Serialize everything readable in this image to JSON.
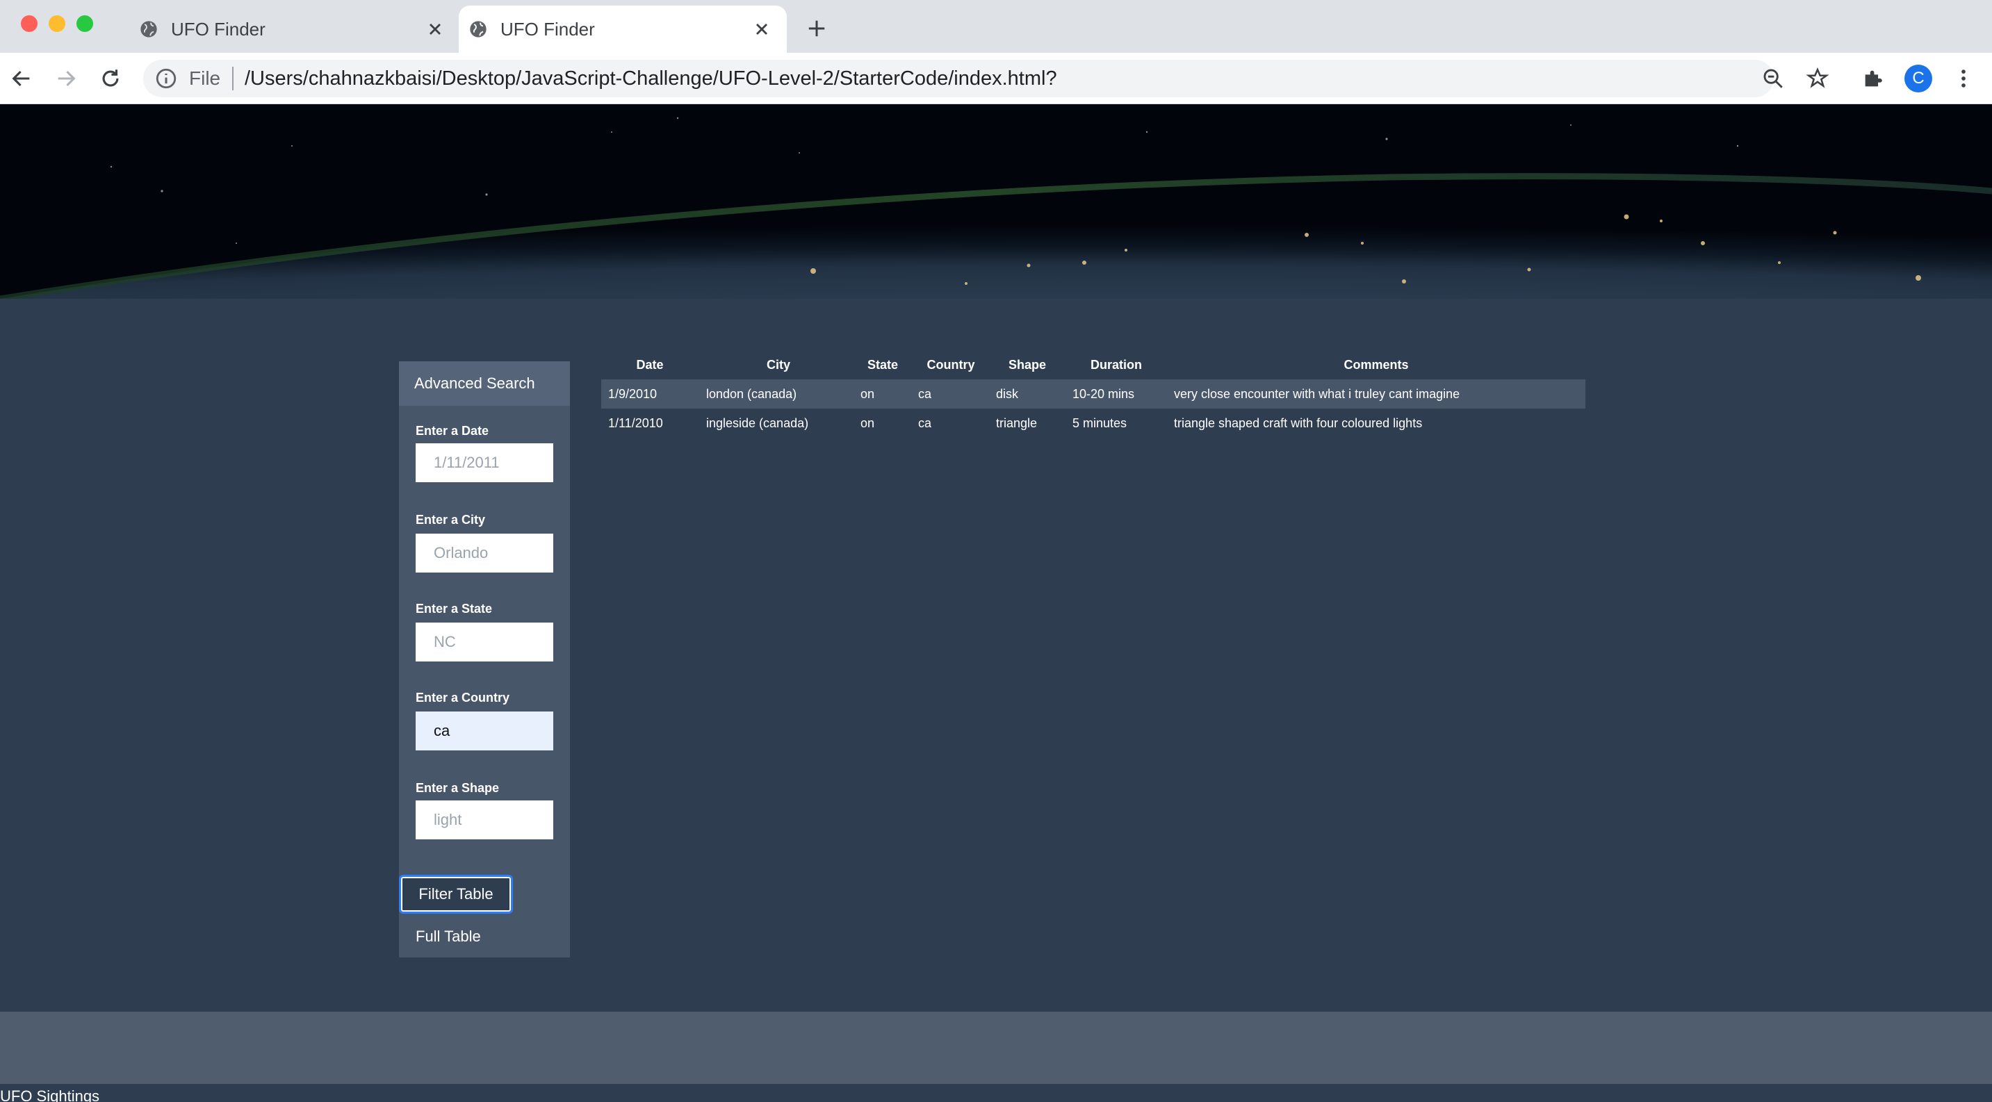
{
  "browser": {
    "tabs": [
      {
        "title": "UFO Finder",
        "active": false
      },
      {
        "title": "UFO Finder",
        "active": true
      }
    ],
    "omnibox": {
      "scheme_label": "File",
      "url": "/Users/chahnazkbaisi/Desktop/JavaScript-Challenge/UFO-Level-2/StarterCode/index.html?"
    },
    "profile_initial": "C",
    "colors": {
      "tab_strip": "#dee1e6",
      "profile": "#1a73e8",
      "close_red": "#ff5f57",
      "minimize_yellow": "#febc2e",
      "maximize_green": "#28c840"
    }
  },
  "sidebar": {
    "title": "Advanced Search",
    "filters": [
      {
        "label": "Enter a Date",
        "placeholder": "1/11/2011",
        "value": ""
      },
      {
        "label": "Enter a City",
        "placeholder": "Orlando",
        "value": ""
      },
      {
        "label": "Enter a State",
        "placeholder": "NC",
        "value": ""
      },
      {
        "label": "Enter a Country",
        "placeholder": "",
        "value": "ca"
      },
      {
        "label": "Enter a Shape",
        "placeholder": "light",
        "value": ""
      }
    ],
    "filter_button": "Filter Table",
    "full_table_link": "Full Table"
  },
  "table": {
    "headers": [
      "Date",
      "City",
      "State",
      "Country",
      "Shape",
      "Duration",
      "Comments"
    ],
    "rows": [
      [
        "1/9/2010",
        "london (canada)",
        "on",
        "ca",
        "disk",
        "10-20 mins",
        "very close encounter with what i truley cant imagine"
      ],
      [
        "1/11/2010",
        "ingleside (canada)",
        "on",
        "ca",
        "triangle",
        "5 minutes",
        "triangle shaped craft with four coloured lights"
      ]
    ]
  },
  "footer": {
    "text": "UFO Sightings"
  },
  "colors": {
    "page_bg": "#2e3d4f",
    "sidebar_bg": "#48566a",
    "row_highlight": "#48566a",
    "footer_band": "#4f5d6e",
    "focus_ring": "#2d7ff9"
  }
}
